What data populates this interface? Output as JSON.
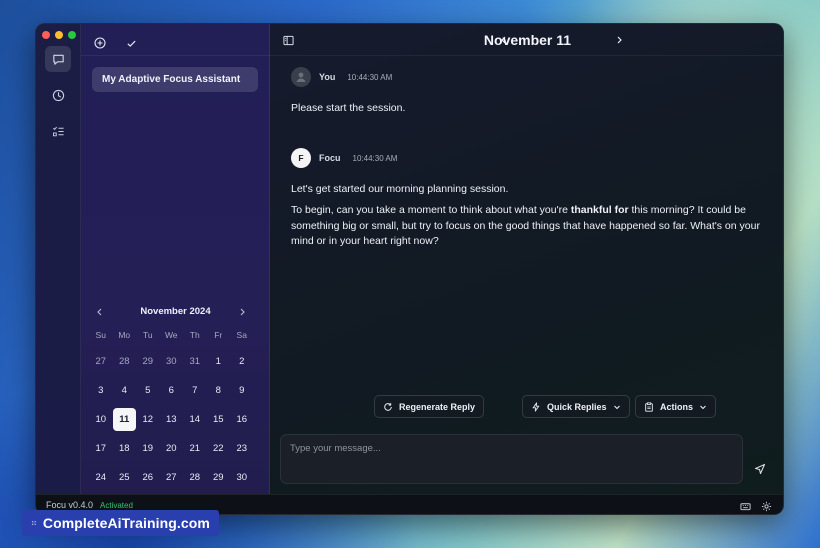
{
  "app": {
    "version_label": "Focu v0.4.0",
    "status": "Activated"
  },
  "sidebar": {
    "conversations": [
      {
        "title": "My Adaptive Focus Assistant"
      }
    ]
  },
  "calendar": {
    "month_label": "November 2024",
    "weekdays": [
      "Su",
      "Mo",
      "Tu",
      "We",
      "Th",
      "Fr",
      "Sa"
    ],
    "weeks": [
      [
        "27",
        "28",
        "29",
        "30",
        "31",
        "1",
        "2"
      ],
      [
        "3",
        "4",
        "5",
        "6",
        "7",
        "8",
        "9"
      ],
      [
        "10",
        "11",
        "12",
        "13",
        "14",
        "15",
        "16"
      ],
      [
        "17",
        "18",
        "19",
        "20",
        "21",
        "22",
        "23"
      ],
      [
        "24",
        "25",
        "26",
        "27",
        "28",
        "29",
        "30"
      ]
    ],
    "outside_month_days_first_week": 5,
    "selected_day": "11"
  },
  "header": {
    "date_title": "November 11"
  },
  "messages": [
    {
      "sender": "You",
      "time": "10:44:30 AM",
      "text": "Please start the session."
    },
    {
      "sender": "Focu",
      "avatar_letter": "F",
      "time": "10:44:30 AM",
      "para1": "Let's get started our morning planning session.",
      "para2_a": "To begin, can you take a moment to think about what you're ",
      "para2_bold": "thankful for",
      "para2_b": " this morning? It could be something big or small, but try to focus on the good things that have happened so far. What's on your mind or in your heart right now?"
    }
  ],
  "actions": {
    "regenerate": "Regenerate Reply",
    "quick_replies": "Quick Replies",
    "actions": "Actions"
  },
  "composer": {
    "placeholder": "Type your message..."
  },
  "watermark": {
    "text": "CompleteAiTraining.com"
  },
  "colors": {
    "rail_bg": "#1b1d44",
    "sidebar_bg": "#221f57",
    "main_bg": "#131822",
    "activated": "#37c26e"
  }
}
